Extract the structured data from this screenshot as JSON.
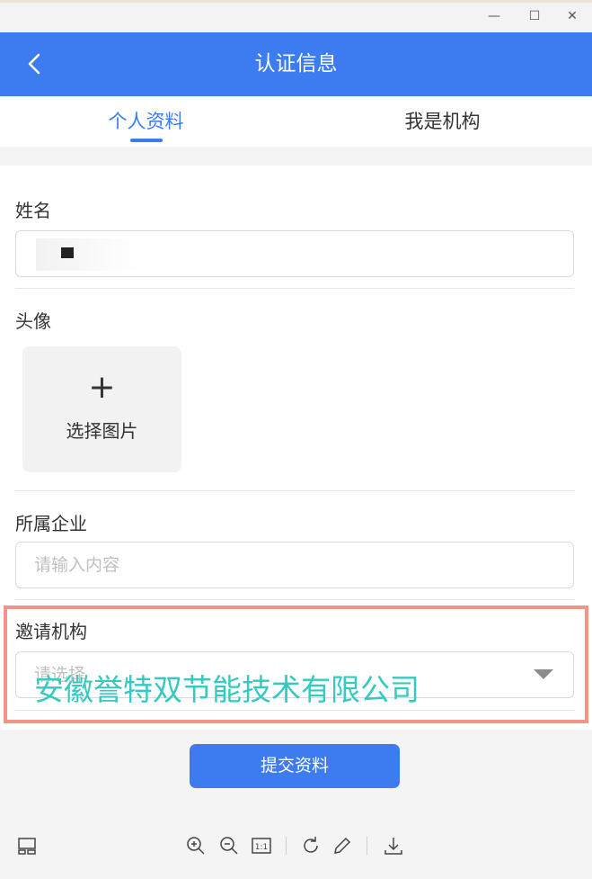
{
  "window": {
    "minimize": "—",
    "maximize": "☐",
    "close": "✕"
  },
  "header": {
    "title": "认证信息"
  },
  "tabs": [
    {
      "label": "个人资料",
      "active": true
    },
    {
      "label": "我是机构",
      "active": false
    }
  ],
  "form": {
    "name_label": "姓名",
    "avatar_label": "头像",
    "upload_plus": "+",
    "upload_text": "选择图片",
    "company_label": "所属企业",
    "company_placeholder": "请输入内容",
    "invite_label": "邀请机构",
    "invite_placeholder": "请选择"
  },
  "annotation": {
    "overlay_text": "安徽誉特双节能技术有限公司",
    "highlight_color": "#f29488",
    "text_color": "#36c9c2"
  },
  "submit": {
    "label": "提交资料"
  },
  "toolbar": {
    "icons": [
      "layout-icon",
      "zoom-in-icon",
      "zoom-out-icon",
      "actual-size-icon",
      "rotate-icon",
      "edit-icon",
      "download-icon"
    ],
    "actual_size_label": "1:1"
  },
  "colors": {
    "accent": "#3d7bf0"
  }
}
